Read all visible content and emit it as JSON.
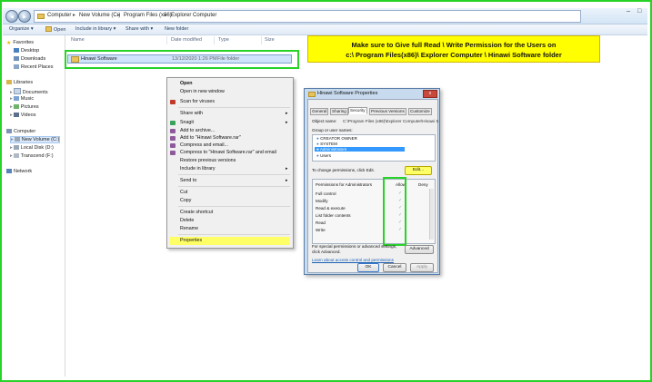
{
  "address": {
    "crumbs": [
      "Computer",
      "New Volume (C:)",
      "Program Files (x86)",
      "Explorer Computer"
    ],
    "back_glyph": "◀",
    "forward_glyph": "▶",
    "minimize": "–",
    "maximize": "□"
  },
  "toolbar": {
    "organize": "Organize ▾",
    "open": "Open",
    "include": "Include in library ▾",
    "share": "Share with ▾",
    "new_folder": "New folder"
  },
  "nav": {
    "favorites": "Favorites",
    "desktop": "Desktop",
    "downloads": "Downloads",
    "recent": "Recent Places",
    "libraries": "Libraries",
    "documents": "Documents",
    "music": "Music",
    "pictures": "Pictures",
    "videos": "Videos",
    "computer": "Computer",
    "new_volume": "New Volume (C:)",
    "local_disk": "Local Disk (D:)",
    "transcend": "Transcend (F:)",
    "network": "Network"
  },
  "columns": {
    "name": "Name",
    "date": "Date modified",
    "type": "Type",
    "size": "Size"
  },
  "file_row": {
    "name": "Hinawi Software",
    "date": "13/12/2020 1:26 PM",
    "type": "File folder"
  },
  "callout": {
    "line1": "Make sure to Give full Read \\ Write Permission for the Users on",
    "line2": "c:\\ Program Files(x86)\\ Explorer Computer \\ Hinawi Software folder"
  },
  "context_menu": {
    "open": "Open",
    "open_new_window": "Open in new window",
    "scan": "Scan for viruses",
    "share_with": "Share with",
    "snagit": "Snagit",
    "add_archive": "Add to archive...",
    "add_rar": "Add to \"Hinawi Software.rar\"",
    "compress_email": "Compress and email...",
    "compress_rar_email": "Compress to \"Hinawi Software.rar\" and email",
    "restore": "Restore previous versions",
    "include": "Include in library",
    "send_to": "Send to",
    "cut": "Cut",
    "copy": "Copy",
    "create_shortcut": "Create shortcut",
    "delete": "Delete",
    "rename": "Rename",
    "properties": "Properties",
    "submenu_arrow": "▸"
  },
  "dialog": {
    "title": "Hinawi Software Properties",
    "close": "x",
    "tabs": [
      "General",
      "Sharing",
      "Security",
      "Previous Versions",
      "Customize"
    ],
    "object_name_label": "Object name:",
    "object_name_value": "C:\\Program Files (x86)\\Explorer Computer\\Hinawi S",
    "group_label": "Group or user names:",
    "groups": [
      "CREATOR OWNER",
      "SYSTEM",
      "Administrators",
      "Users"
    ],
    "change_text": "To change permissions, click Edit.",
    "edit": "Edit...",
    "perm_label": "Permissions for Administrators",
    "allow": "Allow",
    "deny": "Deny",
    "permissions": [
      "Full control",
      "Modify",
      "Read & execute",
      "List folder contents",
      "Read",
      "Write"
    ],
    "check_glyph": "✓",
    "special_text1": "For special permissions or advanced settings,",
    "special_text2": "click Advanced.",
    "advanced": "Advanced",
    "learn_link": "Learn about access control and permissions",
    "ok": "OK",
    "cancel": "Cancel",
    "apply": "Apply"
  },
  "colors": {
    "highlight_green": "#27d327",
    "callout_yellow": "#ffff00",
    "selection_blue": "#cfe3fa"
  }
}
